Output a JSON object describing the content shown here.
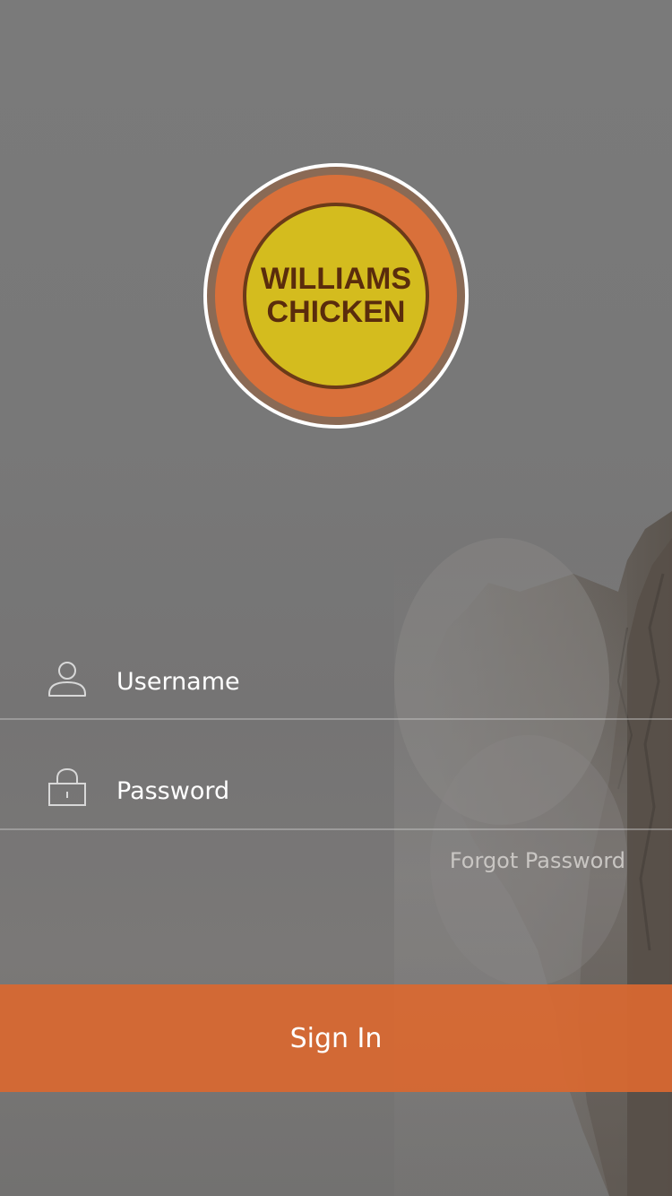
{
  "logo": {
    "line1": "WILLIAMS",
    "line2": "CHICKEN",
    "colors": {
      "outer_ring": "#ffffff",
      "band": "#8a6a55",
      "orange": "#d9703a",
      "inner": "#d4bc1e",
      "text": "#5a2c0c"
    }
  },
  "form": {
    "username": {
      "placeholder": "Username",
      "value": "",
      "icon": "user-icon"
    },
    "password": {
      "placeholder": "Password",
      "value": "",
      "icon": "lock-icon"
    },
    "forgot_label": "Forgot Password"
  },
  "actions": {
    "signin_label": "Sign In"
  },
  "theme": {
    "accent": "#d96830",
    "background": "#787878",
    "divider": "#c8c8c8"
  }
}
